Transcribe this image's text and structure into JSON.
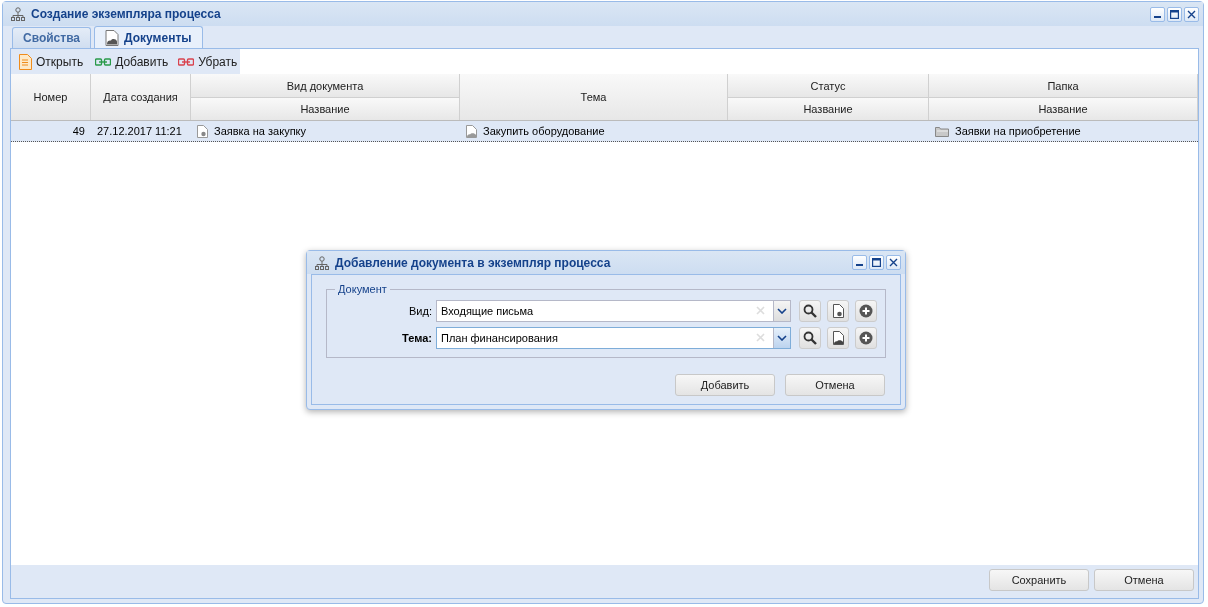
{
  "window": {
    "title": "Создание экземпляра процесса"
  },
  "tabs": [
    {
      "label": "Свойства",
      "selected": false
    },
    {
      "label": "Документы",
      "selected": true
    }
  ],
  "toolbar": [
    {
      "kind": "open",
      "label": "Открыть"
    },
    {
      "kind": "add",
      "label": "Добавить"
    },
    {
      "kind": "remove",
      "label": "Убрать"
    }
  ],
  "table": {
    "columns": [
      {
        "label": "Номер"
      },
      {
        "label": "Дата создания"
      },
      {
        "group": "Вид документа",
        "label": "Название"
      },
      {
        "label": "Тема"
      },
      {
        "group": "Статус",
        "label": "Название"
      },
      {
        "group": "Папка",
        "label": "Название"
      }
    ],
    "rows": [
      {
        "selected": true,
        "number": "49",
        "created": "27.12.2017 11:21",
        "doc_type": "Заявка на закупку",
        "topic": "Закупить оборудование",
        "folder": "Заявки на приобретение"
      }
    ]
  },
  "footer_buttons": [
    "Сохранить",
    "Отмена"
  ],
  "dialog": {
    "title": "Добавление документа в экземпляр процесса",
    "fieldset": "Документ",
    "fields": [
      {
        "kind": "doc_type",
        "label": "Вид:",
        "bold": false,
        "value": "Входящие письма",
        "focused": false
      },
      {
        "kind": "topic",
        "label": "Тема:",
        "bold": true,
        "value": "План финансирования",
        "focused": true
      }
    ],
    "buttons": [
      "Добавить",
      "Отмена"
    ]
  }
}
